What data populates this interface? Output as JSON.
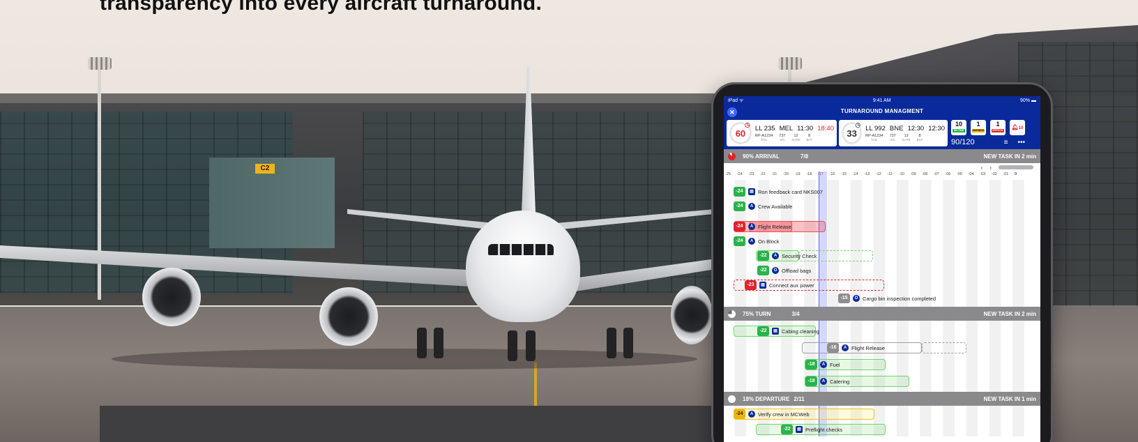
{
  "headline": "transparency into every aircraft turnaround.",
  "scene": {
    "gate_sign": "C2"
  },
  "ipad": {
    "status": {
      "device": "iPad ᯤ",
      "time": "9:41 AM",
      "battery": "90% ▬"
    },
    "app_title": "TURNAROUND MANAGMENT",
    "flights": [
      {
        "timer": "60",
        "flight": "LL 235",
        "dest": "MEL",
        "sched": "11:30",
        "actual": "18:40",
        "tail": "RP-A1234",
        "ac": "737",
        "gate": "12",
        "bay": "8"
      },
      {
        "timer": "33",
        "flight": "LL 992",
        "dest": "BNE",
        "sched": "12:30",
        "actual": "12:30",
        "tail": "RP-A1234",
        "ac": "737",
        "gate": "12",
        "bay": "8"
      }
    ],
    "labels": {
      "tail": "TAIL",
      "ac": "A/C",
      "gate": "GATE",
      "bay": "BAY"
    },
    "counters": [
      {
        "value": "10",
        "label": "ON TIME",
        "color": "#21b34a"
      },
      {
        "value": "1",
        "label": "WARNING",
        "color": "#f0b400"
      },
      {
        "value": "1",
        "label": "CRITICAL",
        "color": "#d7262b"
      }
    ],
    "alarm_value": "10",
    "progress": "90/120",
    "sections": [
      {
        "title": "90% ARRIVAL",
        "count": "7/8",
        "newtask": "NEW TASK IN 2 min",
        "pie_color": "#e02429"
      },
      {
        "title": "75% TURN",
        "count": "3/4",
        "newtask": "NEW TASK IN 2 min",
        "pie_color": "#ffffff"
      },
      {
        "title": "18% DEPARTURE",
        "count": "2/11",
        "newtask": "NEW TASK IN 1 min",
        "pie_color": "#ffffff"
      }
    ],
    "nav": {
      "prev": "‹",
      "next": "›"
    },
    "ticks": [
      "-25",
      "-24",
      "-23",
      "-22",
      "-21",
      "-20",
      "-19",
      "-18",
      "-17",
      "-16",
      "-15",
      "-14",
      "-13",
      "-12",
      "-11",
      "-10",
      "-09",
      "-08",
      "-07",
      "-06",
      "-05",
      "-04",
      "-03",
      "-02",
      "-01",
      "0"
    ],
    "arrival_tasks": [
      {
        "badge": "-24",
        "role": "▤",
        "label": "Ron feedback card NKS007"
      },
      {
        "badge": "-24",
        "role": "A",
        "label": "Crew Available"
      },
      {
        "badge": "-24",
        "role": "A",
        "label": "Flight Release"
      },
      {
        "badge": "-24",
        "role": "A",
        "label": "On Block"
      },
      {
        "badge": "-22",
        "role": "A",
        "label": "Security Check"
      },
      {
        "badge": "-22",
        "role": "O",
        "label": "Offload bags"
      },
      {
        "badge": "-23",
        "role": "▤",
        "label": "Connect aux power"
      },
      {
        "badge": "-15",
        "role": "O",
        "label": "Cargo bin inspection completed"
      }
    ],
    "turn_tasks": [
      {
        "badge": "-22",
        "role": "▤",
        "label": "Cabing cleaning"
      },
      {
        "badge": "-16",
        "role": "A",
        "label": "Flight Release"
      },
      {
        "badge": "-18",
        "role": "A",
        "label": "Fuel"
      },
      {
        "badge": "-18",
        "role": "A",
        "label": "Catering"
      }
    ],
    "departure_tasks": [
      {
        "badge": "-24",
        "role": "A",
        "label": "Verify crew in MCWeb"
      },
      {
        "badge": "-22",
        "role": "▤",
        "label": "Preflight checks"
      }
    ]
  }
}
